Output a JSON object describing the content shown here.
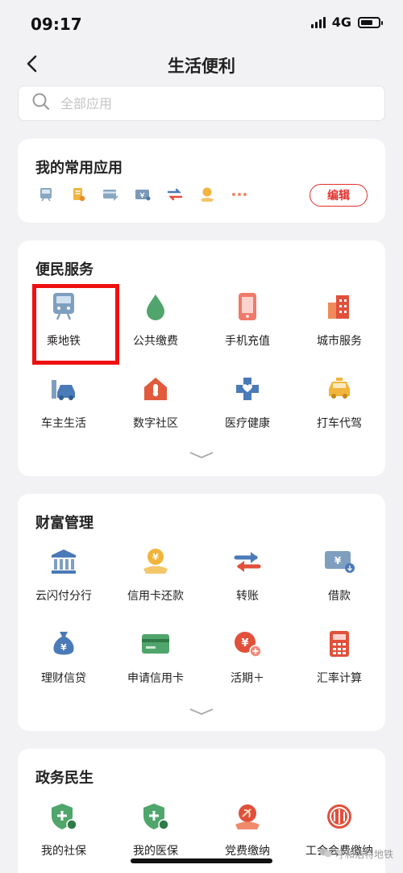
{
  "status_bar": {
    "time": "09:17",
    "network": "4G"
  },
  "nav": {
    "title": "生活便利"
  },
  "search": {
    "placeholder": "全部应用"
  },
  "favorites": {
    "title": "我的常用应用",
    "icons": [
      "train-icon",
      "bill-icon",
      "card-icon",
      "wallet-icon",
      "transfer-icon",
      "hand-coin-icon",
      "more-dots-icon"
    ],
    "edit_label": "编辑"
  },
  "convenience": {
    "title": "便民服务",
    "items": [
      {
        "label": "乘地铁",
        "icon": "metro-icon"
      },
      {
        "label": "公共缴费",
        "icon": "water-drop-icon"
      },
      {
        "label": "手机充值",
        "icon": "phone-icon"
      },
      {
        "label": "城市服务",
        "icon": "city-buildings-icon"
      },
      {
        "label": "车主生活",
        "icon": "car-icon"
      },
      {
        "label": "数字社区",
        "icon": "house-icon"
      },
      {
        "label": "医疗健康",
        "icon": "medical-cross-icon"
      },
      {
        "label": "打车代驾",
        "icon": "taxi-icon"
      }
    ]
  },
  "wealth": {
    "title": "财富管理",
    "items": [
      {
        "label": "云闪付分行",
        "icon": "bank-icon"
      },
      {
        "label": "信用卡还款",
        "icon": "coin-hand-icon"
      },
      {
        "label": "转账",
        "icon": "transfer-arrows-icon"
      },
      {
        "label": "借款",
        "icon": "yen-card-icon"
      },
      {
        "label": "理财信贷",
        "icon": "money-bag-icon"
      },
      {
        "label": "申请信用卡",
        "icon": "credit-card-icon"
      },
      {
        "label": "活期＋",
        "icon": "yen-plus-icon"
      },
      {
        "label": "汇率计算",
        "icon": "calculator-icon"
      }
    ]
  },
  "government": {
    "title": "政务民生",
    "items": [
      {
        "label": "我的社保",
        "icon": "social-security-shield-icon"
      },
      {
        "label": "我的医保",
        "icon": "medical-insurance-shield-icon"
      },
      {
        "label": "党费缴纳",
        "icon": "party-emblem-icon"
      },
      {
        "label": "工会会费缴纳",
        "icon": "union-emblem-icon"
      }
    ]
  },
  "watermark": "呼和浩特地铁"
}
